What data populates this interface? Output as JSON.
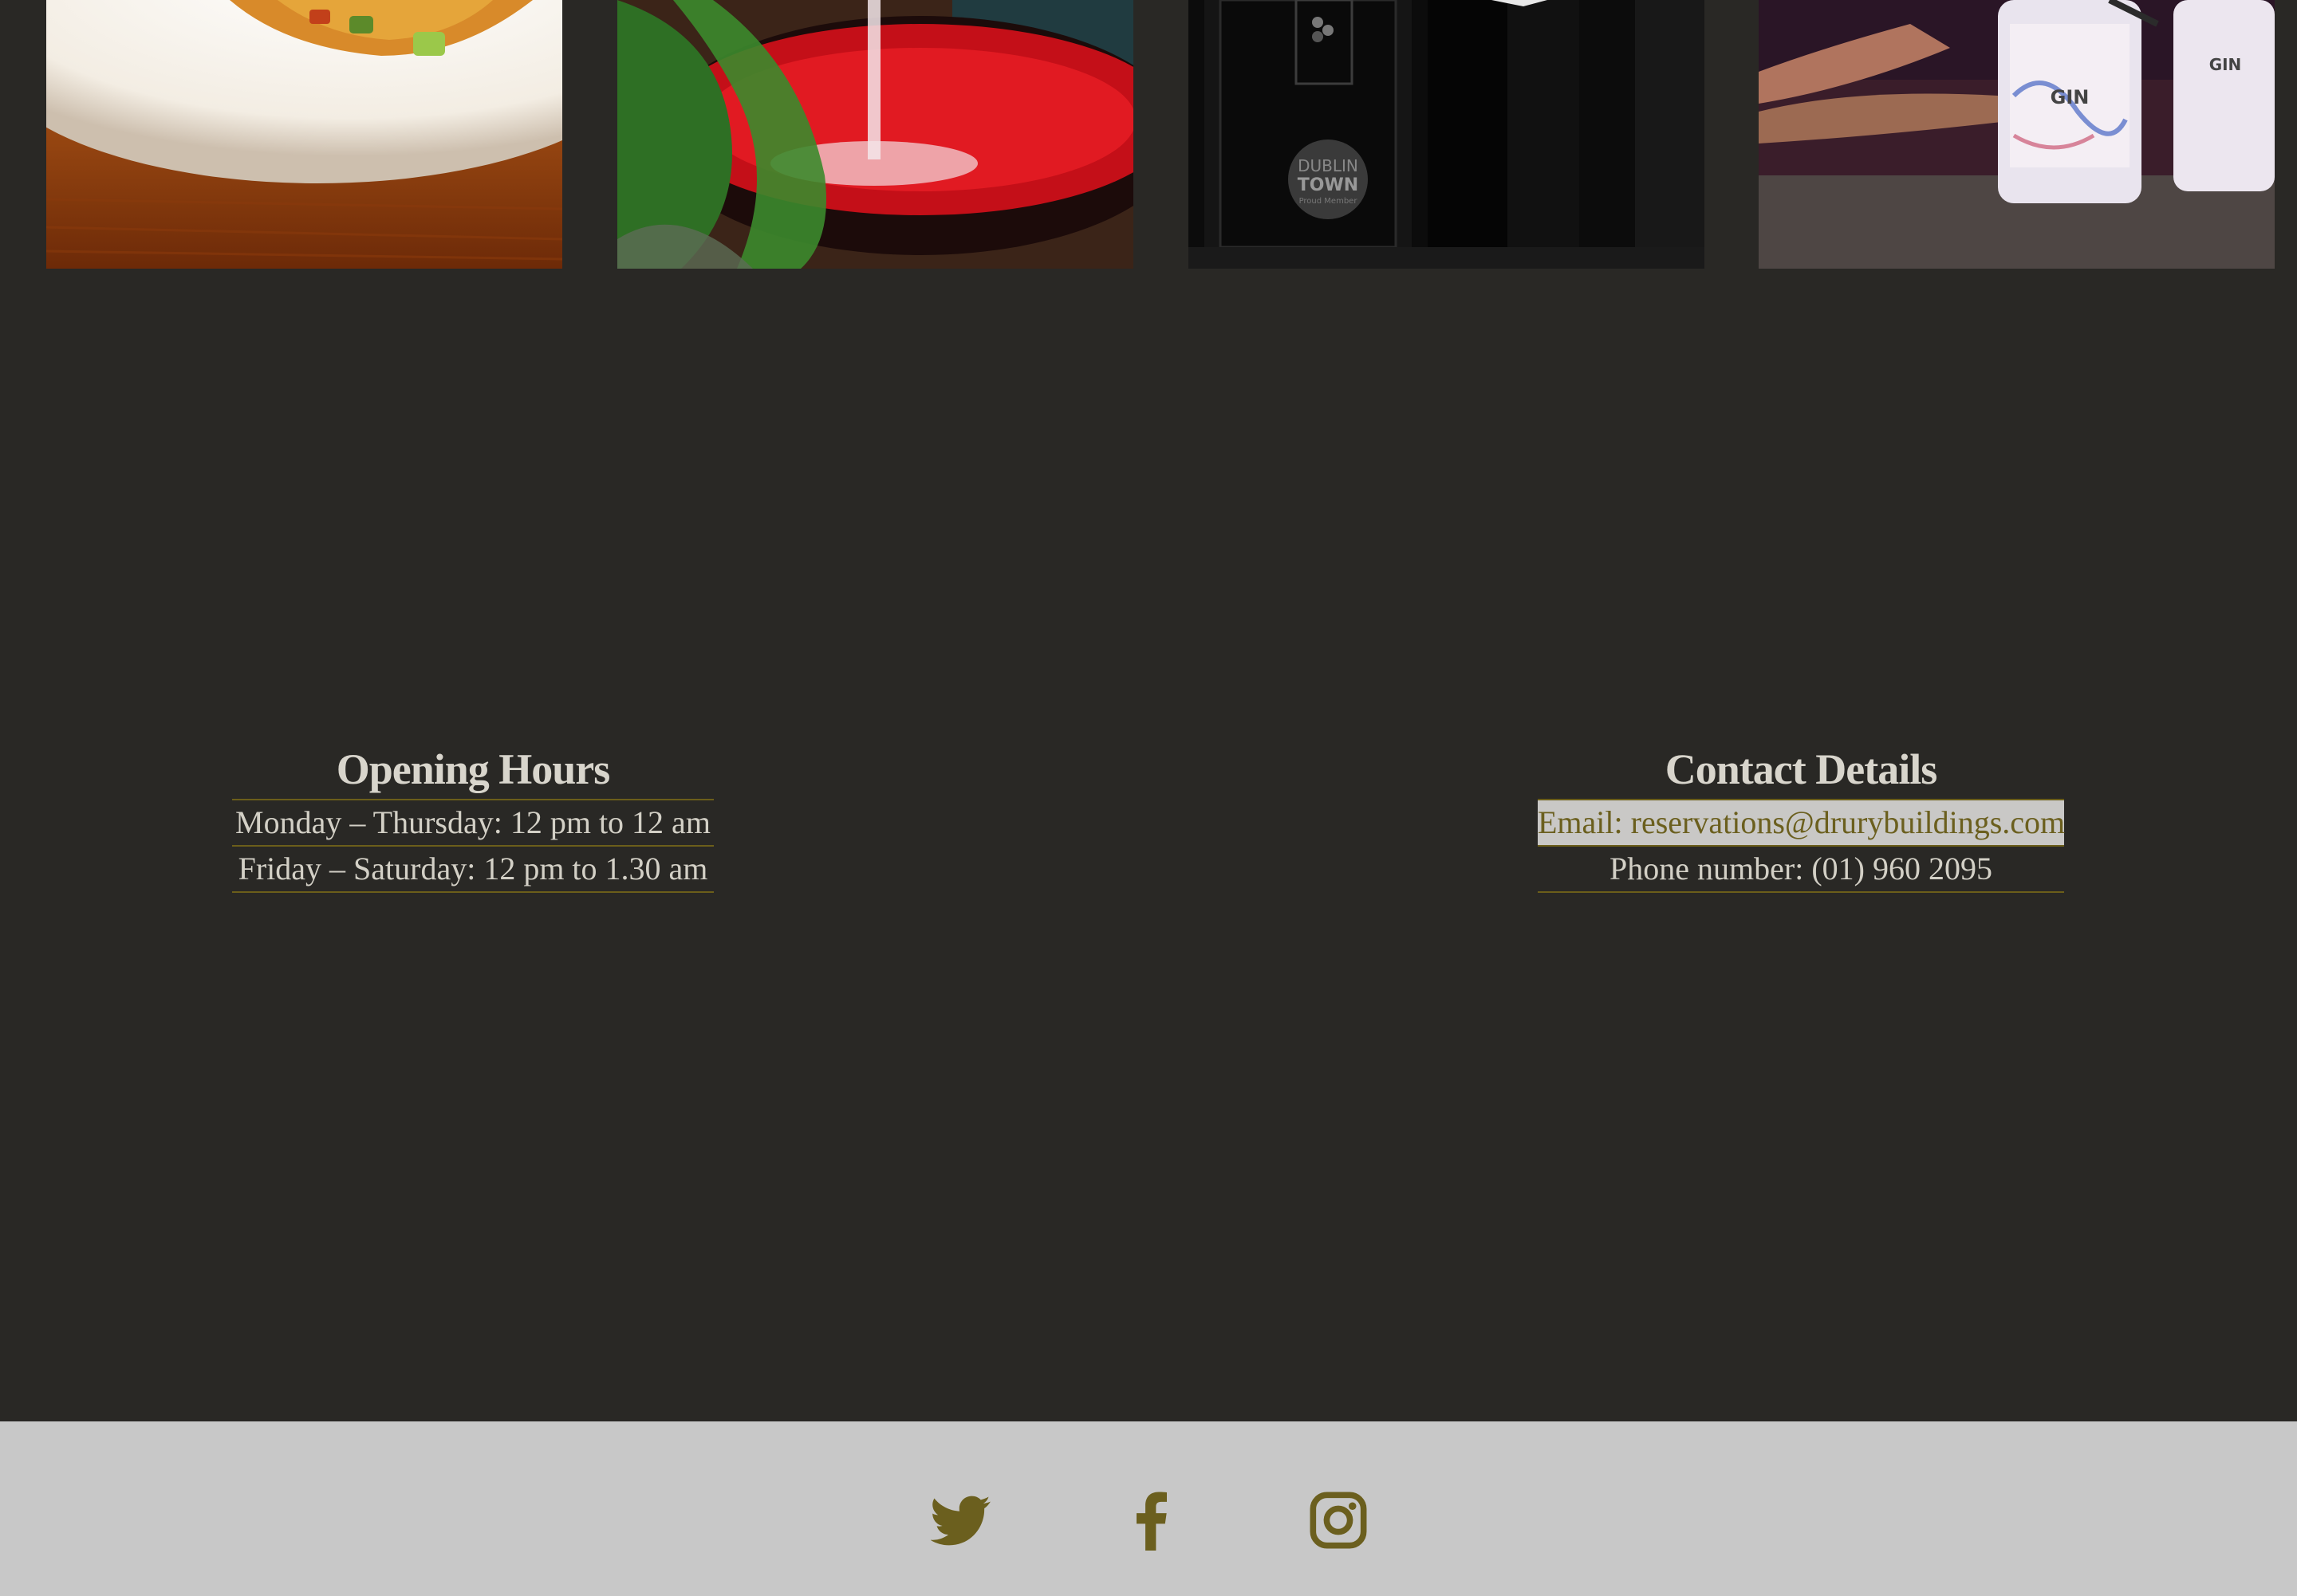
{
  "gallery": {
    "images": [
      {
        "icon": "food-plate-photo"
      },
      {
        "icon": "wine-glass-photo"
      },
      {
        "icon": "doorway-photo",
        "sticker_text": [
          "DUBLIN",
          "TOWN",
          "Proud Member"
        ]
      },
      {
        "icon": "gin-bottles-photo",
        "label_text": "GIN"
      }
    ]
  },
  "opening_hours": {
    "title": "Opening Hours",
    "lines": [
      "Monday – Thursday: 12 pm to 12 am",
      "Friday – Saturday: 12 pm to 1.30 am"
    ]
  },
  "contact": {
    "title": "Contact Details",
    "email": "Email: reservations@drurybuildings.com",
    "phone": "Phone number: (01) 960 2095"
  },
  "footer": {
    "social": [
      {
        "name": "twitter",
        "icon": "twitter-icon"
      },
      {
        "name": "facebook",
        "icon": "facebook-icon"
      },
      {
        "name": "instagram",
        "icon": "instagram-icon"
      }
    ]
  },
  "colors": {
    "background": "#292825",
    "accent": "#6b5f1e",
    "footer_bg": "#c8c8c8",
    "text": "#d5d2c8"
  }
}
